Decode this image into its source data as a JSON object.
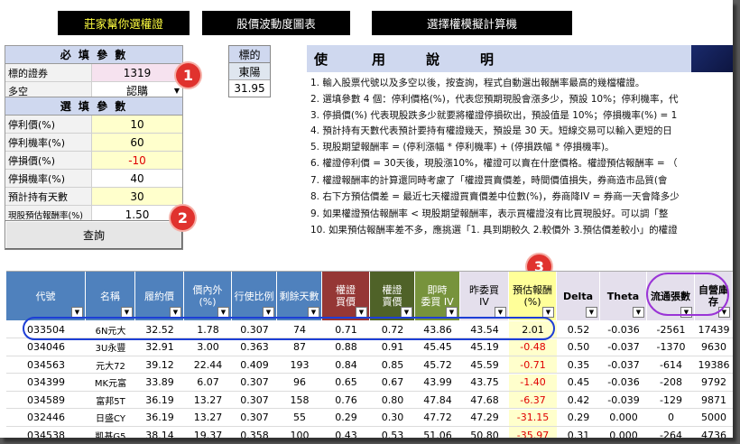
{
  "nav": {
    "btn1": "莊家幫你選權證",
    "btn2": "股價波動度圖表",
    "btn3": "選擇權模擬計算機"
  },
  "required": {
    "header": "必 填 參 數",
    "underlying_code_label": "標的證券",
    "underlying_code": "1319",
    "direction_label": "多空",
    "direction_value": "認購"
  },
  "optional": {
    "header": "選 填 參 數",
    "rows": [
      {
        "label": "停利價(%)",
        "value": "10"
      },
      {
        "label": "停利機率(%)",
        "value": "60"
      },
      {
        "label": "停損價(%)",
        "value": "-10"
      },
      {
        "label": "停損機率(%)",
        "value": "40"
      },
      {
        "label": "預計持有天數",
        "value": "30"
      },
      {
        "label": "現股預估報酬率(%)",
        "value": "1.50"
      }
    ]
  },
  "calc_button": "查詢",
  "underlying": {
    "header": "標的",
    "name": "東陽",
    "price": "31.95"
  },
  "instructions": {
    "title_chars": [
      "使",
      "用",
      "說",
      "明"
    ],
    "lines": [
      "1. 輸入股票代號以及多空以後，按查詢，程式自動選出報酬率最高的幾檔權證。",
      "2. 選填參數 4 個：停利價格(%)，代表您預期現股會漲多少，預設 10%；停利機率，代",
      "3. 停損價(%) 代表現股跌多少就要將權證停損砍出，預設值是 10%；停損機率(%) = 1",
      "4. 預計持有天數代表預計要持有權證幾天，預設是 30 天。短線交易可以輸入更短的日",
      "5. 現股期望報酬率 = (停利漲幅 * 停利機率) + (停損跌幅 * 停損機率)。",
      "6. 權證停利價 = 30天後，現股漲10%，權證可以賣在什麼價格。權證預估報酬率 = （",
      "7. 權證報酬率的計算還同時考慮了「權證買賣價差，時間價值損失，券商造市品質(會",
      "8. 右下方預估價差 = 最近七天權證買賣價差中位數(%)，券商降IV = 券商一天會降多少",
      "9. 如果權證預估報酬率 < 現股期望報酬率，表示買權證沒有比買現股好。可以調「整",
      "10. 如果預估報酬率差不多，應挑選「1. 具到期較久 2.較價外 3.預估價差較小」的權證"
    ]
  },
  "badges": [
    "1",
    "2",
    "3"
  ],
  "table": {
    "headers": [
      {
        "text": "代號",
        "bg": "#4f81bd",
        "color": "#ffffff"
      },
      {
        "text": "名稱",
        "bg": "#4f81bd",
        "color": "#ffffff"
      },
      {
        "text": "履約價",
        "bg": "#4f81bd",
        "color": "#ffffff"
      },
      {
        "text": "價內外\n(%)",
        "bg": "#4f81bd",
        "color": "#ffffff"
      },
      {
        "text": "行使比例",
        "bg": "#4f81bd",
        "color": "#ffffff"
      },
      {
        "text": "剩餘天數",
        "bg": "#4f81bd",
        "color": "#ffffff"
      },
      {
        "text": "權證\n買價",
        "bg": "#953735",
        "color": "#ffffff"
      },
      {
        "text": "權證\n賣價",
        "bg": "#4f6228",
        "color": "#ffffff"
      },
      {
        "text": "即時\n委買 IV",
        "bg": "#77933c",
        "color": "#ffffff"
      },
      {
        "text": "昨委買\nIV",
        "bg": "#e4dfec",
        "color": "#000000"
      },
      {
        "text": "預估報酬\n(%)",
        "bg": "#ffff99",
        "color": "#000000"
      },
      {
        "text": "Delta",
        "bg": "#e4dfec",
        "color": "#000000"
      },
      {
        "text": "Theta",
        "bg": "#e4dfec",
        "color": "#000000"
      },
      {
        "text": "流通張數",
        "bg": "#e4dfec",
        "color": "#000000"
      },
      {
        "text": "自營庫存",
        "bg": "#e4dfec",
        "color": "#000000"
      }
    ],
    "rows": [
      [
        "033504",
        "6N元大",
        "32.52",
        "1.78",
        "0.307",
        "74",
        "0.71",
        "0.72",
        "43.86",
        "43.54",
        "2.01",
        "0.52",
        "-0.036",
        "-2561",
        "17439"
      ],
      [
        "034046",
        "3U永豐",
        "32.91",
        "3.00",
        "0.363",
        "87",
        "0.88",
        "0.91",
        "45.45",
        "45.19",
        "-0.48",
        "0.50",
        "-0.037",
        "-1370",
        "9630"
      ],
      [
        "034563",
        "元大72",
        "39.12",
        "22.44",
        "0.409",
        "193",
        "0.84",
        "0.85",
        "45.72",
        "45.59",
        "-0.71",
        "0.35",
        "-0.037",
        "-614",
        "19386"
      ],
      [
        "034399",
        "MK元富",
        "33.89",
        "6.07",
        "0.307",
        "96",
        "0.65",
        "0.67",
        "43.99",
        "43.75",
        "-1.40",
        "0.45",
        "-0.036",
        "-208",
        "9792"
      ],
      [
        "034589",
        "富邦5T",
        "36.19",
        "13.27",
        "0.307",
        "158",
        "0.76",
        "0.80",
        "47.84",
        "47.68",
        "-6.37",
        "0.42",
        "-0.039",
        "-129",
        "9871"
      ],
      [
        "032446",
        "日盛CY",
        "36.19",
        "13.27",
        "0.307",
        "55",
        "0.29",
        "0.30",
        "47.72",
        "47.29",
        "-31.15",
        "0.29",
        "0.000",
        "0",
        "5000"
      ],
      [
        "034538",
        "凱基G5",
        "38.14",
        "19.37",
        "0.358",
        "100",
        "0.43",
        "0.53",
        "51.06",
        "50.80",
        "-35.97",
        "0.31",
        "0.000",
        "-264",
        "4736"
      ]
    ]
  }
}
